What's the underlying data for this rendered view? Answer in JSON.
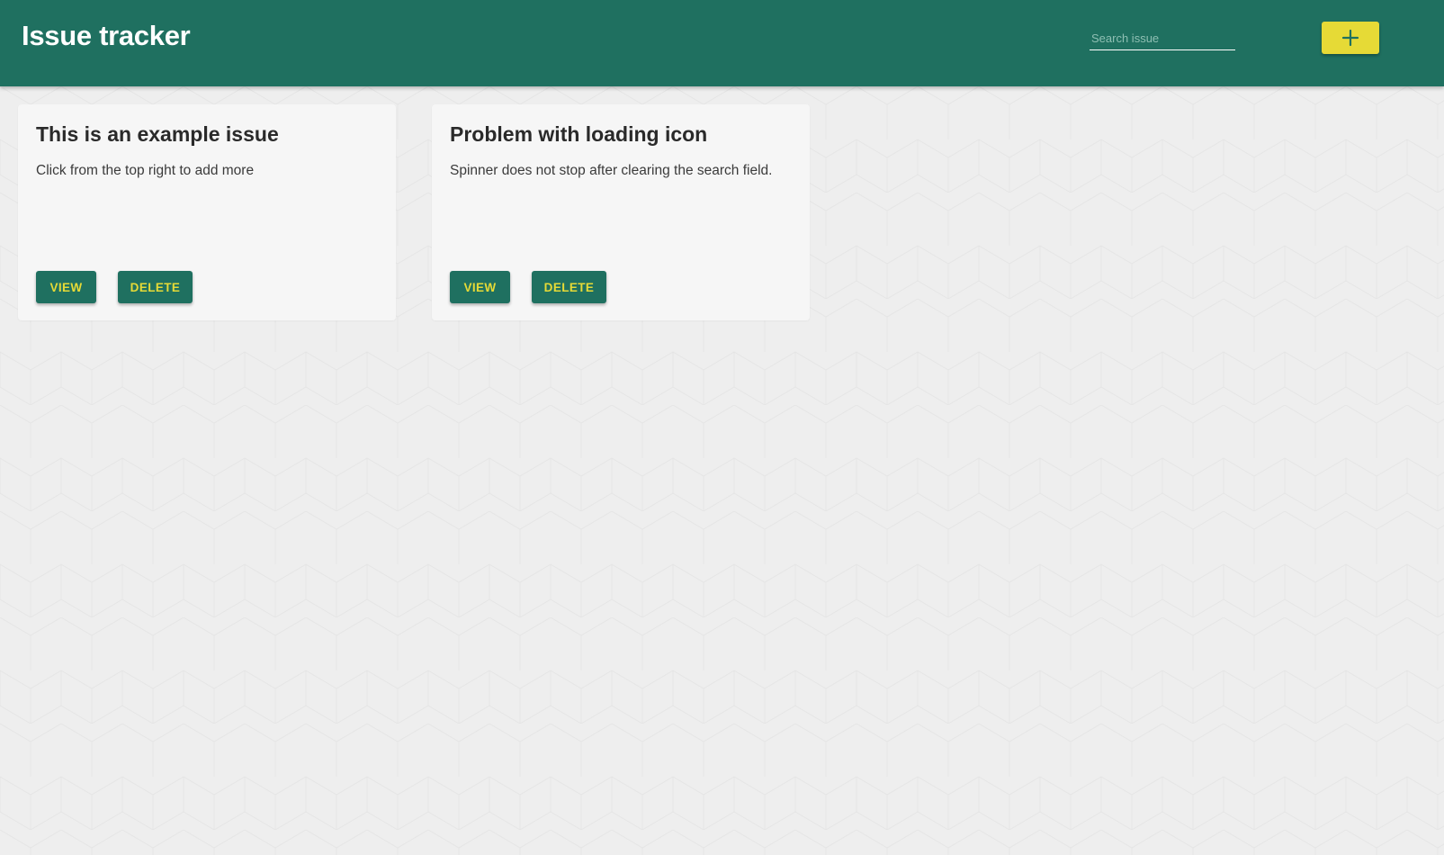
{
  "header": {
    "title": "Issue tracker",
    "search_placeholder": "Search issue",
    "search_value": "",
    "add_button_icon": "plus-icon",
    "colors": {
      "primary": "#1f7060",
      "accent": "#e6da36"
    }
  },
  "issues": [
    {
      "title": "This is an example issue",
      "description": "Click from the top right to add more",
      "view_label": "VIEW",
      "delete_label": "DELETE"
    },
    {
      "title": "Problem with loading icon",
      "description": "Spinner does not stop after clearing the search field.",
      "view_label": "VIEW",
      "delete_label": "DELETE"
    }
  ]
}
